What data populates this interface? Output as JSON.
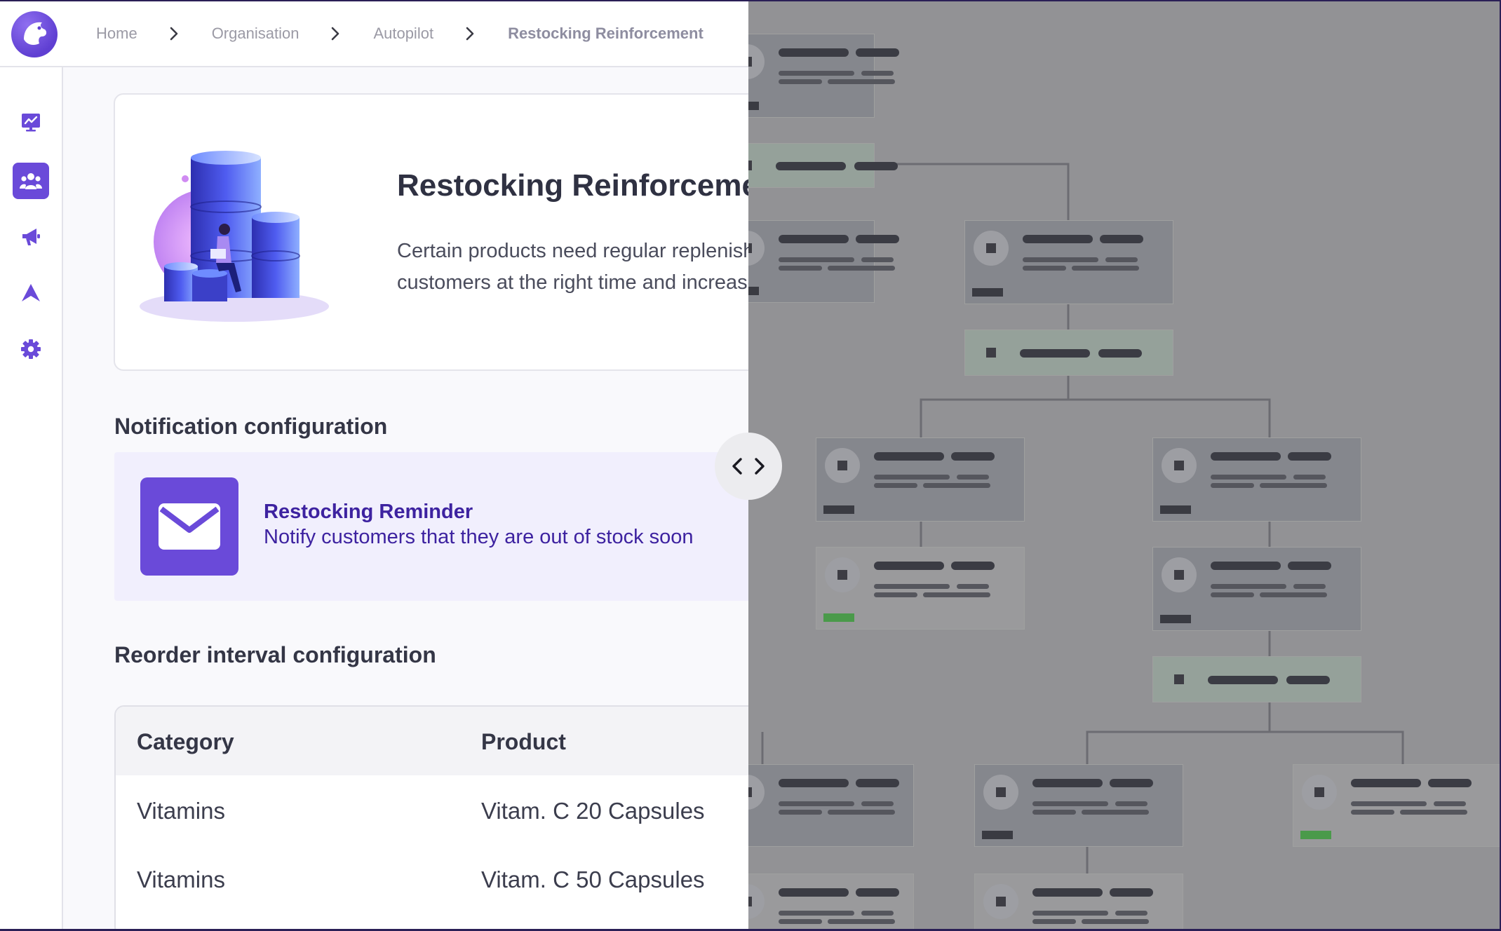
{
  "breadcrumb": {
    "items": [
      "Home",
      "Organisation",
      "Autopilot",
      "Restocking Reinforcement"
    ]
  },
  "sidebar": {
    "items": [
      {
        "icon": "dashboard-chart-icon",
        "active": false
      },
      {
        "icon": "audience-group-icon",
        "active": true
      },
      {
        "icon": "megaphone-icon",
        "active": false
      },
      {
        "icon": "autopilot-icon",
        "active": false
      },
      {
        "icon": "gear-icon",
        "active": false
      }
    ]
  },
  "hero": {
    "title": "Restocking Reinforcement",
    "description": "Certain products need regular replenishment. Remind customers at the right time and increase retention."
  },
  "notification": {
    "section_title": "Notification configuration",
    "title": "Restocking Reminder",
    "description": "Notify customers that they are out of stock soon"
  },
  "reorder": {
    "section_title": "Reorder interval configuration",
    "columns": [
      "Category",
      "Product"
    ],
    "rows": [
      [
        "Vitamins",
        "Vitam. C 20 Capsules"
      ],
      [
        "Vitamins",
        "Vitam. C 50 Capsules"
      ]
    ]
  },
  "colors": {
    "accent": "#6a4ad9",
    "accent_dark": "#3d22a0",
    "overlay": "#929295",
    "success": "#4a9a4a"
  }
}
